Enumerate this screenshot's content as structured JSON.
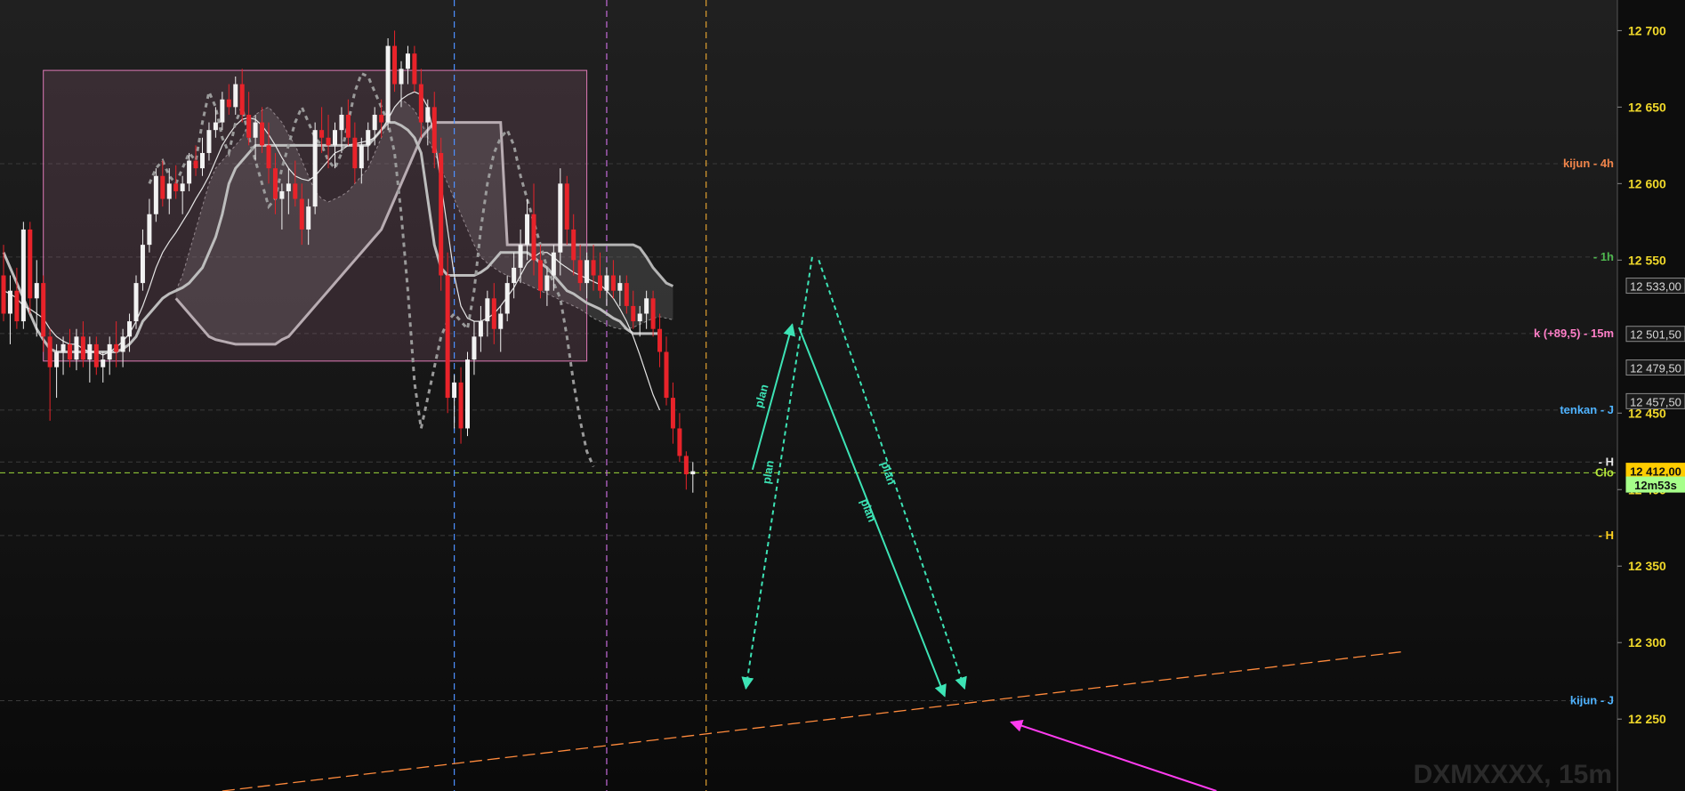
{
  "chart_data": {
    "type": "candlestick",
    "watermark": "DXMXXXX, 15m",
    "ylim": [
      12203,
      12720
    ],
    "y_ticks": [
      12700,
      12650,
      12600,
      12550,
      12450,
      12400,
      12350,
      12300,
      12250
    ],
    "y_tick_labels": [
      "12 700",
      "12 650",
      "12 600",
      "12 550",
      "12 450",
      "12 400",
      "12 350",
      "12 300",
      "12 250"
    ],
    "price_tags": [
      {
        "label": "12 533,00",
        "value": 12533.0,
        "style": "dark"
      },
      {
        "label": "12 501,50",
        "value": 12501.5,
        "style": "dark"
      },
      {
        "label": "12 479,50",
        "value": 12479.5,
        "style": "dark"
      },
      {
        "label": "12 457,50",
        "value": 12457.5,
        "style": "dark"
      },
      {
        "label": "12 412,00",
        "value": 12412.0,
        "style": "yellow"
      },
      {
        "label": "12m53s",
        "value": 12403.0,
        "style": "green"
      }
    ],
    "levels": [
      {
        "label": "kijun - 4h",
        "value": 12613,
        "color": "#f0844a"
      },
      {
        "label": "- 1h",
        "value": 12552,
        "color": "#4fb84f"
      },
      {
        "label": "k (+89,5) - 15m",
        "value": 12502,
        "color": "#ff7fc8"
      },
      {
        "label": "tenkan - J",
        "value": 12452,
        "color": "#4fb3ff"
      },
      {
        "label": "- H",
        "value": 12418,
        "color": "#e8e8e8"
      },
      {
        "label": "Clo",
        "value": 12411,
        "color": "#b6e63c"
      },
      {
        "label": "- H",
        "value": 12370,
        "color": "#ffd21f"
      },
      {
        "label": "kijun - J",
        "value": 12262,
        "color": "#4fb3ff"
      }
    ],
    "close_price": 12411,
    "box": {
      "x1": 6,
      "x2": 88,
      "y1": 12484,
      "y2": 12674
    },
    "vlines": [
      {
        "x": 68,
        "color": "#4d8fff"
      },
      {
        "x": 91,
        "color": "#c36bd8"
      },
      {
        "x": 106,
        "color": "#e0a030"
      }
    ],
    "trendline": {
      "x1": 33,
      "y1": 12203,
      "x2": 211,
      "y2": 12294,
      "color": "#ff8a3c"
    },
    "plan_paths": [
      {
        "from": [
          113,
          12413
        ],
        "to": [
          119,
          12508
        ],
        "style": "solid",
        "label": "plan"
      },
      {
        "from": [
          120,
          12506
        ],
        "to": [
          142,
          12265
        ],
        "style": "solid",
        "label": "plan"
      },
      {
        "from": [
          122,
          12552
        ],
        "to": [
          112,
          12270
        ],
        "style": "dashed",
        "label": "plan"
      },
      {
        "from": [
          123,
          12550
        ],
        "to": [
          145,
          12270
        ],
        "style": "dashed",
        "label": "plan"
      }
    ],
    "magenta_arrow": {
      "from": [
        183,
        12203
      ],
      "to": [
        152,
        12248
      ]
    },
    "candles": [
      [
        12540,
        12560,
        12510,
        12515
      ],
      [
        12515,
        12540,
        12495,
        12530
      ],
      [
        12530,
        12545,
        12505,
        12510
      ],
      [
        12510,
        12575,
        12505,
        12570
      ],
      [
        12570,
        12575,
        12515,
        12525
      ],
      [
        12525,
        12550,
        12500,
        12535
      ],
      [
        12535,
        12540,
        12490,
        12500
      ],
      [
        12500,
        12505,
        12445,
        12480
      ],
      [
        12480,
        12495,
        12460,
        12490
      ],
      [
        12490,
        12500,
        12475,
        12495
      ],
      [
        12495,
        12505,
        12480,
        12485
      ],
      [
        12485,
        12505,
        12478,
        12500
      ],
      [
        12500,
        12510,
        12480,
        12485
      ],
      [
        12485,
        12500,
        12470,
        12495
      ],
      [
        12495,
        12500,
        12475,
        12480
      ],
      [
        12480,
        12490,
        12470,
        12485
      ],
      [
        12485,
        12500,
        12475,
        12495
      ],
      [
        12495,
        12510,
        12480,
        12490
      ],
      [
        12490,
        12505,
        12480,
        12500
      ],
      [
        12500,
        12515,
        12490,
        12510
      ],
      [
        12510,
        12540,
        12505,
        12535
      ],
      [
        12535,
        12570,
        12530,
        12560
      ],
      [
        12560,
        12590,
        12555,
        12580
      ],
      [
        12580,
        12610,
        12575,
        12605
      ],
      [
        12605,
        12615,
        12585,
        12590
      ],
      [
        12590,
        12610,
        12580,
        12600
      ],
      [
        12600,
        12612,
        12590,
        12595
      ],
      [
        12595,
        12605,
        12580,
        12600
      ],
      [
        12600,
        12620,
        12595,
        12615
      ],
      [
        12615,
        12625,
        12605,
        12610
      ],
      [
        12610,
        12630,
        12605,
        12620
      ],
      [
        12620,
        12640,
        12615,
        12635
      ],
      [
        12635,
        12650,
        12630,
        12640
      ],
      [
        12640,
        12660,
        12635,
        12655
      ],
      [
        12655,
        12665,
        12645,
        12650
      ],
      [
        12650,
        12670,
        12645,
        12665
      ],
      [
        12665,
        12675,
        12640,
        12645
      ],
      [
        12645,
        12660,
        12625,
        12630
      ],
      [
        12630,
        12645,
        12615,
        12640
      ],
      [
        12640,
        12650,
        12620,
        12625
      ],
      [
        12625,
        12640,
        12600,
        12610
      ],
      [
        12610,
        12620,
        12580,
        12590
      ],
      [
        12590,
        12600,
        12570,
        12595
      ],
      [
        12595,
        12610,
        12580,
        12600
      ],
      [
        12600,
        12615,
        12585,
        12590
      ],
      [
        12590,
        12600,
        12560,
        12570
      ],
      [
        12570,
        12590,
        12560,
        12585
      ],
      [
        12585,
        12640,
        12580,
        12635
      ],
      [
        12635,
        12650,
        12620,
        12630
      ],
      [
        12630,
        12645,
        12610,
        12625
      ],
      [
        12625,
        12640,
        12610,
        12635
      ],
      [
        12635,
        12650,
        12620,
        12645
      ],
      [
        12645,
        12655,
        12625,
        12630
      ],
      [
        12630,
        12640,
        12600,
        12610
      ],
      [
        12610,
        12630,
        12600,
        12625
      ],
      [
        12625,
        12640,
        12615,
        12635
      ],
      [
        12635,
        12650,
        12625,
        12645
      ],
      [
        12645,
        12655,
        12630,
        12640
      ],
      [
        12640,
        12695,
        12635,
        12690
      ],
      [
        12690,
        12700,
        12660,
        12665
      ],
      [
        12665,
        12680,
        12650,
        12675
      ],
      [
        12675,
        12690,
        12665,
        12685
      ],
      [
        12685,
        12690,
        12660,
        12665
      ],
      [
        12665,
        12675,
        12630,
        12640
      ],
      [
        12640,
        12655,
        12625,
        12650
      ],
      [
        12650,
        12660,
        12610,
        12620
      ],
      [
        12620,
        12630,
        12530,
        12540
      ],
      [
        12540,
        12555,
        12450,
        12460
      ],
      [
        12460,
        12475,
        12440,
        12470
      ],
      [
        12470,
        12480,
        12430,
        12440
      ],
      [
        12440,
        12490,
        12435,
        12485
      ],
      [
        12485,
        12510,
        12475,
        12500
      ],
      [
        12500,
        12520,
        12490,
        12510
      ],
      [
        12510,
        12530,
        12500,
        12525
      ],
      [
        12525,
        12535,
        12495,
        12505
      ],
      [
        12505,
        12520,
        12490,
        12515
      ],
      [
        12515,
        12540,
        12510,
        12535
      ],
      [
        12535,
        12555,
        12525,
        12545
      ],
      [
        12545,
        12570,
        12535,
        12560
      ],
      [
        12560,
        12590,
        12550,
        12580
      ],
      [
        12580,
        12600,
        12540,
        12550
      ],
      [
        12550,
        12560,
        12525,
        12530
      ],
      [
        12530,
        12545,
        12520,
        12540
      ],
      [
        12540,
        12560,
        12530,
        12555
      ],
      [
        12555,
        12610,
        12540,
        12600
      ],
      [
        12600,
        12605,
        12560,
        12570
      ],
      [
        12570,
        12580,
        12540,
        12550
      ],
      [
        12550,
        12560,
        12530,
        12535
      ],
      [
        12535,
        12555,
        12525,
        12550
      ],
      [
        12550,
        12560,
        12530,
        12540
      ],
      [
        12540,
        12555,
        12525,
        12530
      ],
      [
        12530,
        12545,
        12520,
        12540
      ],
      [
        12540,
        12550,
        12525,
        12530
      ],
      [
        12530,
        12540,
        12520,
        12535
      ],
      [
        12535,
        12540,
        12515,
        12520
      ],
      [
        12520,
        12530,
        12505,
        12510
      ],
      [
        12510,
        12520,
        12500,
        12515
      ],
      [
        12515,
        12530,
        12505,
        12525
      ],
      [
        12525,
        12530,
        12500,
        12505
      ],
      [
        12505,
        12515,
        12480,
        12490
      ],
      [
        12490,
        12500,
        12455,
        12460
      ],
      [
        12460,
        12470,
        12430,
        12440
      ],
      [
        12440,
        12450,
        12418,
        12422
      ],
      [
        12422,
        12425,
        12400,
        12410
      ],
      [
        12410,
        12418,
        12398,
        12412
      ]
    ],
    "tenkan": [
      12530,
      12528,
      12525,
      12520,
      12518,
      12515,
      12512,
      12505,
      12500,
      12497,
      12495,
      12495,
      12492,
      12490,
      12490,
      12488,
      12490,
      12493,
      12497,
      12502,
      12510,
      12520,
      12532,
      12545,
      12555,
      12562,
      12568,
      12575,
      12582,
      12590,
      12597,
      12605,
      12615,
      12625,
      12632,
      12638,
      12642,
      12643,
      12642,
      12638,
      12632,
      12625,
      12617,
      12610,
      12605,
      12603,
      12602,
      12605,
      12610,
      12615,
      12620,
      12622,
      12625,
      12626,
      12627,
      12628,
      12630,
      12635,
      12642,
      12650,
      12655,
      12658,
      12660,
      12658,
      12650,
      12630,
      12600,
      12570,
      12540,
      12520,
      12512,
      12510,
      12510,
      12512,
      12515,
      12520,
      12526,
      12532,
      12540,
      12548,
      12552,
      12555,
      12555,
      12552,
      12548,
      12545,
      12542,
      12540,
      12538,
      12536,
      12534,
      12530,
      12525,
      12518,
      12510,
      12500,
      12488,
      12475,
      12462,
      12452
    ],
    "kijun": [
      12555,
      12545,
      12535,
      12525,
      12515,
      12505,
      12498,
      12492,
      12490,
      12490,
      12490,
      12490,
      12490,
      12490,
      12490,
      12490,
      12490,
      12490,
      12492,
      12495,
      12500,
      12510,
      12515,
      12520,
      12525,
      12528,
      12530,
      12532,
      12535,
      12540,
      12545,
      12555,
      12565,
      12580,
      12600,
      12610,
      12615,
      12620,
      12625,
      12625,
      12625,
      12625,
      12625,
      12625,
      12625,
      12625,
      12625,
      12625,
      12625,
      12625,
      12625,
      12625,
      12625,
      12625,
      12625,
      12625,
      12630,
      12635,
      12640,
      12640,
      12638,
      12635,
      12630,
      12620,
      12590,
      12560,
      12545,
      12540,
      12540,
      12540,
      12540,
      12540,
      12542,
      12545,
      12550,
      12555,
      12555,
      12555,
      12555,
      12555,
      12552,
      12548,
      12545,
      12540,
      12535,
      12530,
      12528,
      12525,
      12522,
      12520,
      12518,
      12515,
      12512,
      12510,
      12505,
      12502,
      12502,
      12502,
      12502,
      12502
    ],
    "chikou": [
      12600,
      12610,
      12615,
      12605,
      12600,
      12610,
      12620,
      12615,
      12640,
      12660,
      12650,
      12630,
      12620,
      12640,
      12650,
      12630,
      12615,
      12600,
      12585,
      12590,
      12610,
      12625,
      12640,
      12650,
      12640,
      12630,
      12625,
      12615,
      12610,
      12620,
      12640,
      12660,
      12672,
      12670,
      12660,
      12650,
      12640,
      12620,
      12580,
      12530,
      12470,
      12440,
      12460,
      12480,
      12500,
      12510,
      12515,
      12510,
      12505,
      12530,
      12570,
      12600,
      12620,
      12630,
      12635,
      12625,
      12605,
      12590,
      12575,
      12560,
      12545,
      12535,
      12525,
      12500,
      12470,
      12445,
      12425,
      12415
    ],
    "cloud_offset": 26,
    "senkou_a": [
      12530,
      12540,
      12555,
      12570,
      12585,
      12600,
      12610,
      12615,
      12620,
      12625,
      12630,
      12640,
      12645,
      12648,
      12650,
      12645,
      12640,
      12632,
      12625,
      12615,
      12605,
      12595,
      12590,
      12588,
      12590,
      12592,
      12595,
      12600,
      12605,
      12610,
      12620,
      12630,
      12642,
      12650,
      12655,
      12652,
      12648,
      12640,
      12630,
      12620,
      12610,
      12600,
      12590,
      12580,
      12570,
      12560,
      12552,
      12548,
      12545,
      12542,
      12540,
      12538,
      12536,
      12534,
      12532,
      12530,
      12528,
      12526,
      12524,
      12522,
      12520,
      12518,
      12515,
      12512,
      12510,
      12508,
      12506,
      12505,
      12505,
      12506,
      12508,
      12510,
      12512,
      12513,
      12512,
      12511
    ],
    "senkou_b": [
      12525,
      12520,
      12515,
      12510,
      12505,
      12500,
      12498,
      12497,
      12496,
      12495,
      12495,
      12495,
      12495,
      12495,
      12495,
      12495,
      12498,
      12500,
      12505,
      12510,
      12515,
      12520,
      12525,
      12530,
      12535,
      12540,
      12545,
      12550,
      12555,
      12560,
      12565,
      12570,
      12580,
      12590,
      12600,
      12610,
      12620,
      12630,
      12635,
      12640,
      12640,
      12640,
      12640,
      12640,
      12640,
      12640,
      12640,
      12640,
      12640,
      12640,
      12560,
      12560,
      12560,
      12560,
      12560,
      12560,
      12560,
      12560,
      12560,
      12560,
      12560,
      12560,
      12560,
      12560,
      12560,
      12560,
      12560,
      12560,
      12560,
      12560,
      12558,
      12552,
      12545,
      12540,
      12535,
      12533
    ]
  }
}
